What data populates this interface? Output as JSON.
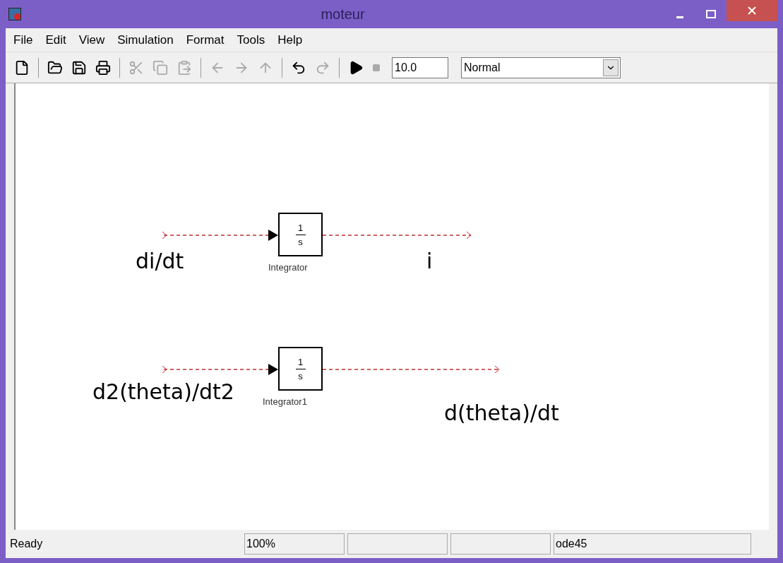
{
  "window": {
    "title": "moteur"
  },
  "menu": [
    "File",
    "Edit",
    "View",
    "Simulation",
    "Format",
    "Tools",
    "Help"
  ],
  "toolbar": [
    {
      "kind": "new",
      "disabled": false
    },
    {
      "kind": "sep"
    },
    {
      "kind": "open",
      "disabled": false
    },
    {
      "kind": "save",
      "disabled": false
    },
    {
      "kind": "print",
      "disabled": false
    },
    {
      "kind": "sep"
    },
    {
      "kind": "cut",
      "disabled": true
    },
    {
      "kind": "copy",
      "disabled": true
    },
    {
      "kind": "paste",
      "disabled": true
    },
    {
      "kind": "sep"
    },
    {
      "kind": "back",
      "disabled": true
    },
    {
      "kind": "forward",
      "disabled": true
    },
    {
      "kind": "up",
      "disabled": true
    },
    {
      "kind": "sep"
    },
    {
      "kind": "undo",
      "disabled": false
    },
    {
      "kind": "redo",
      "disabled": true
    },
    {
      "kind": "sep"
    },
    {
      "kind": "play",
      "disabled": false
    },
    {
      "kind": "stop",
      "disabled": true
    }
  ],
  "stop_time": "10.0",
  "mode": "Normal",
  "blocks": [
    {
      "numerator": "1",
      "denominator": "s",
      "name": "Integrator",
      "input": "di/dt",
      "output": "i"
    },
    {
      "numerator": "1",
      "denominator": "s",
      "name": "Integrator1",
      "input": "d2(theta)/dt2",
      "output": "d(theta)/dt"
    }
  ],
  "status_bar": {
    "message": "Ready",
    "zoom": "100%",
    "solver": "ode45"
  }
}
